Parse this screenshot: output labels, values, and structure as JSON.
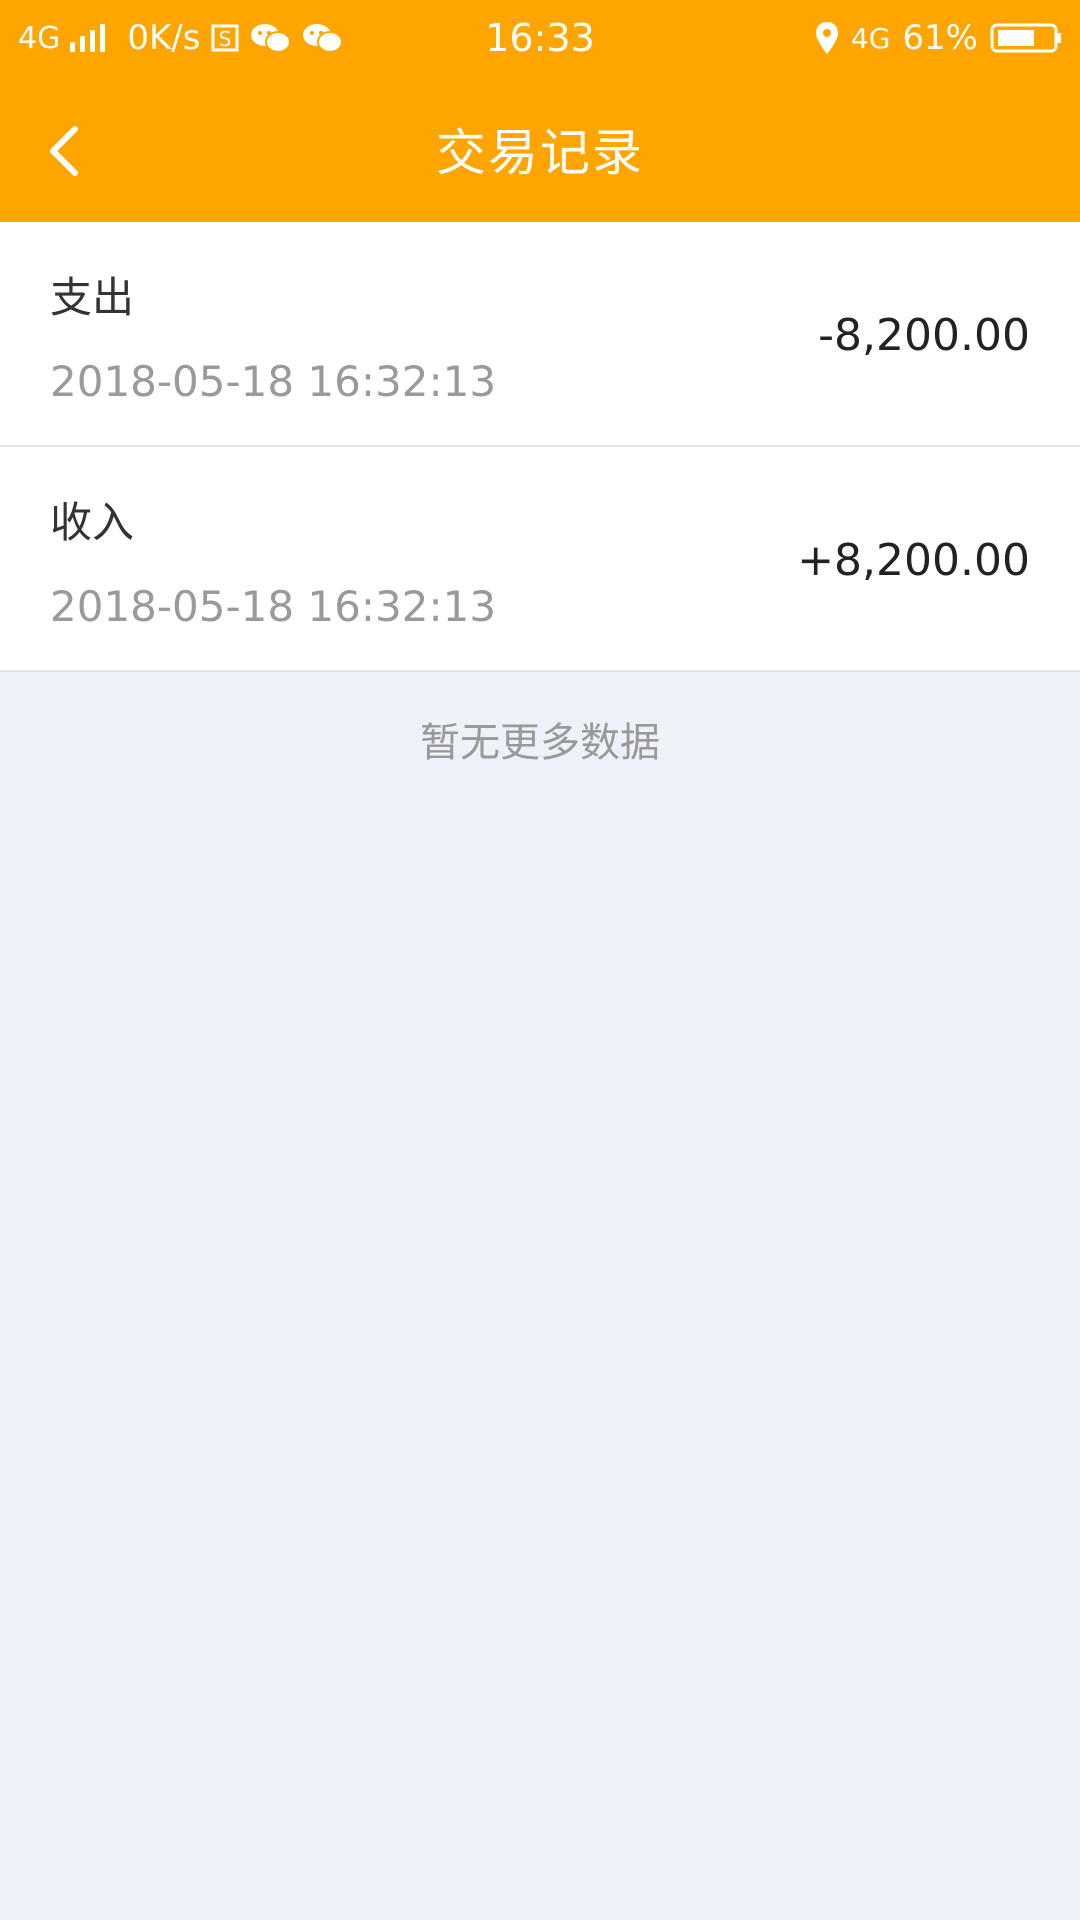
{
  "status_bar": {
    "network_type": "4G",
    "speed": "0K/s",
    "time": "16:33",
    "network_type_right": "4G",
    "battery": "61%",
    "icons": [
      "signal-bars-icon",
      "sim-s-icon",
      "wechat-icon",
      "wechat-icon",
      "location-pin-icon",
      "battery-icon"
    ]
  },
  "header": {
    "back_icon": "chevron-left-icon",
    "title": "交易记录"
  },
  "records": [
    {
      "type": "支出",
      "time": "2018-05-18 16:32:13",
      "amount": "-8,200.00"
    },
    {
      "type": "收入",
      "time": "2018-05-18 16:32:13",
      "amount": "+8,200.00"
    }
  ],
  "footer": {
    "no_more_text": "暂无更多数据"
  },
  "colors": {
    "accent": "#ffa500",
    "background": "#edf1f8",
    "row_bg": "#ffffff",
    "muted_text": "#9a9a9a"
  }
}
